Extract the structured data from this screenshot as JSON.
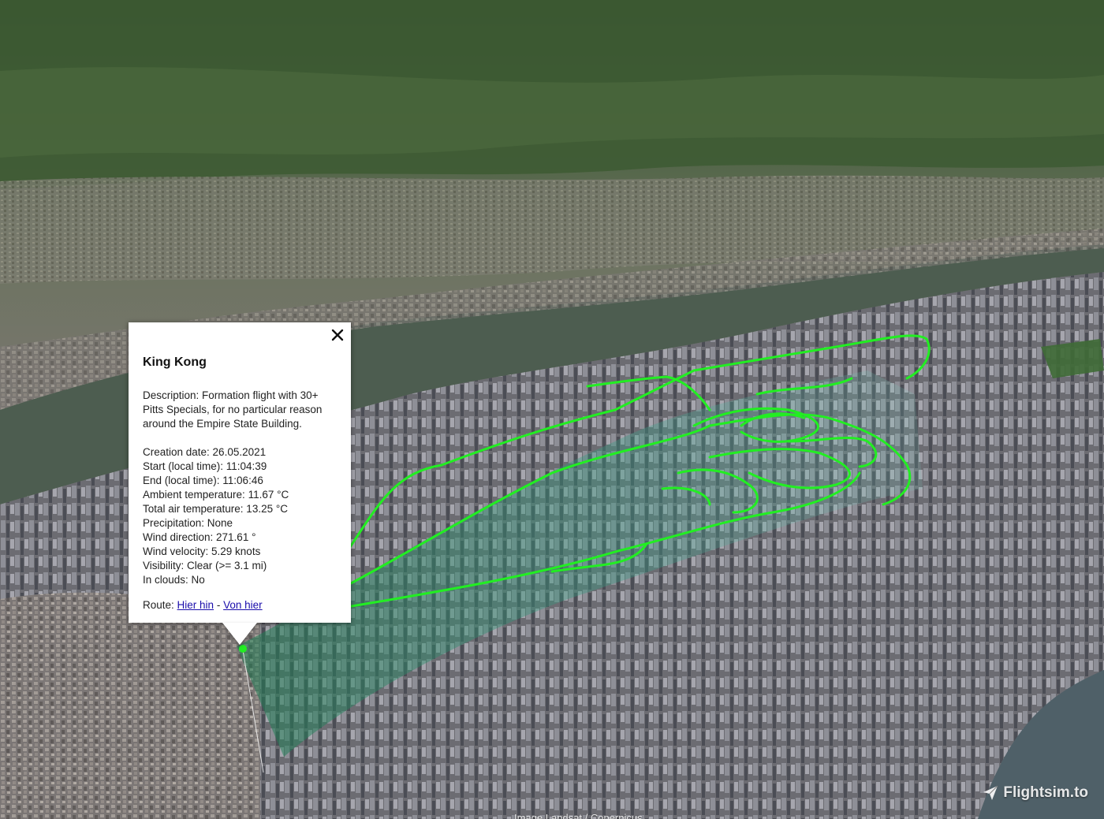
{
  "balloon": {
    "title": "King Kong",
    "description": "Description: Formation flight with 30+ Pitts Specials, for no particular reason around the Empire State Building.",
    "facts": [
      "Creation date: 26.05.2021",
      "Start (local time): 11:04:39",
      "End (local time): 11:06:46",
      "Ambient temperature: 11.67 °C",
      "Total air temperature: 13.25 °C",
      "Precipitation: None",
      "Wind direction: 271.61 °",
      "Wind velocity: 5.29 knots",
      "Visibility: Clear (>= 3.1 mi)",
      "In clouds: No"
    ],
    "route_label": "Route:",
    "route_separator": "-",
    "route_to_link": "Hier hin",
    "route_from_link": "Von hier",
    "close_icon": "close-icon"
  },
  "watermark": {
    "text": "Flightsim.to",
    "icon": "paper-plane-icon"
  },
  "attribution": "Image Landsat / Copernicus",
  "colors": {
    "track": "#22ee22",
    "river": "#4a5a4e",
    "link": "#1a0dab"
  }
}
